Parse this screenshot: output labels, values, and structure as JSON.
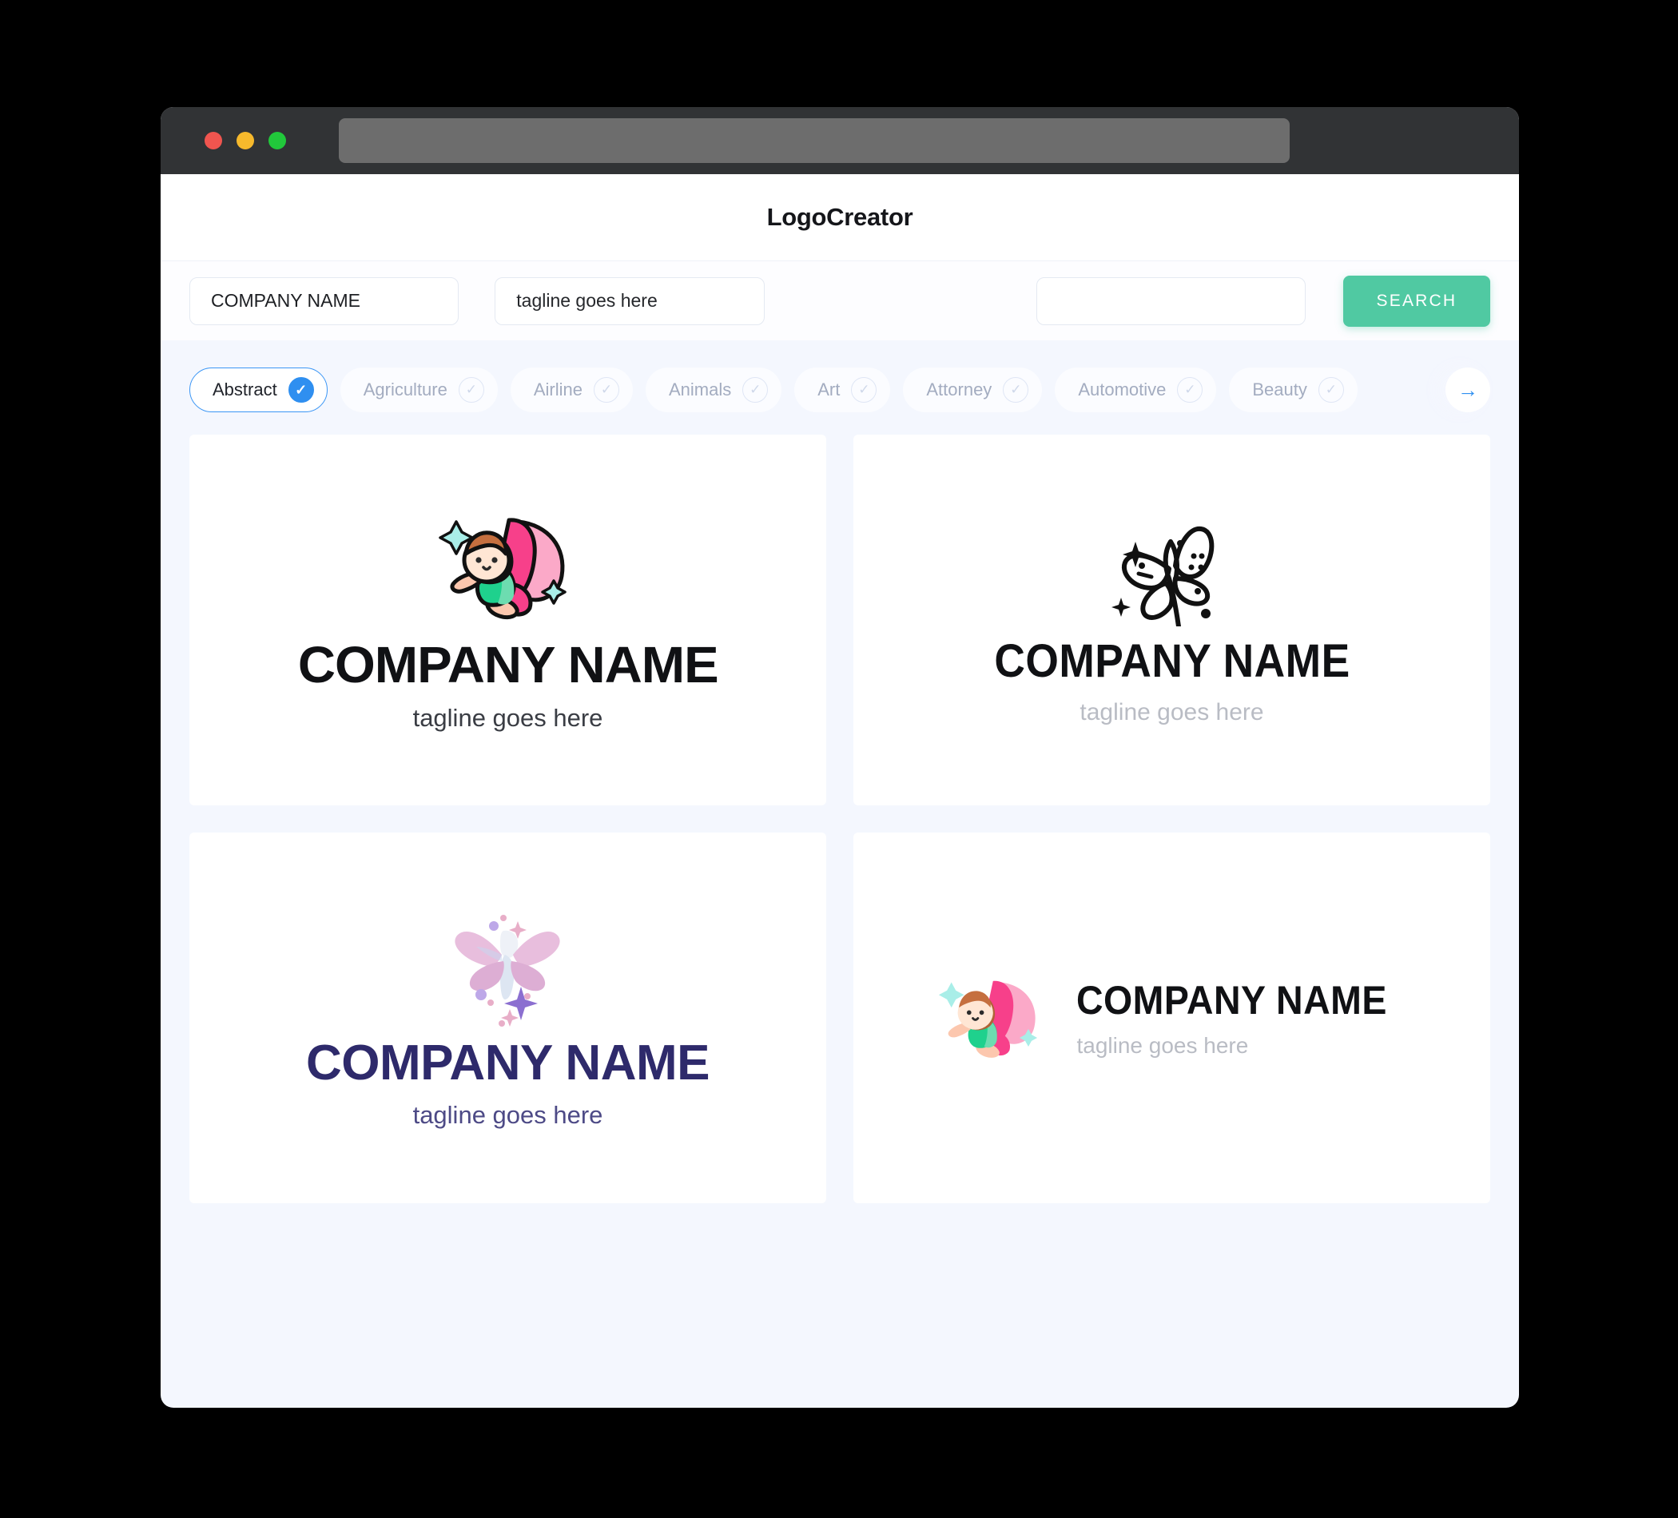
{
  "window": {
    "traffic_lights": [
      {
        "name": "close",
        "color": "#f0554f"
      },
      {
        "name": "minimize",
        "color": "#f6b92c"
      },
      {
        "name": "maximize",
        "color": "#21c83b"
      }
    ],
    "url_value": "",
    "url_placeholder": ""
  },
  "header": {
    "title": "LogoCreator"
  },
  "search": {
    "company_value": "COMPANY NAME",
    "company_placeholder": "COMPANY NAME",
    "tagline_value": "tagline goes here",
    "tagline_placeholder": "tagline goes here",
    "extra_value": "",
    "extra_placeholder": "",
    "button_label": "SEARCH",
    "button_color": "#50c9a2"
  },
  "categories": {
    "next_icon": "arrow-right-icon",
    "accent_color": "#2f8ff0",
    "items": [
      {
        "label": "Abstract",
        "selected": true
      },
      {
        "label": "Agriculture",
        "selected": false
      },
      {
        "label": "Airline",
        "selected": false
      },
      {
        "label": "Animals",
        "selected": false
      },
      {
        "label": "Art",
        "selected": false
      },
      {
        "label": "Attorney",
        "selected": false
      },
      {
        "label": "Automotive",
        "selected": false
      },
      {
        "label": "Beauty",
        "selected": false
      }
    ]
  },
  "logos": [
    {
      "id": "logo-1",
      "icon": "fairy-outlined-icon",
      "name": "COMPANY NAME",
      "tagline": "tagline goes here",
      "name_color": "#101114",
      "tagline_color": "#3a3d44",
      "layout": "stacked"
    },
    {
      "id": "logo-2",
      "icon": "butterfly-lineart-icon",
      "name": "COMPANY NAME",
      "tagline": "tagline goes here",
      "name_color": "#101114",
      "tagline_color": "#b9bcc4",
      "layout": "stacked"
    },
    {
      "id": "logo-3",
      "icon": "butterfly-fairy-pink-icon",
      "name": "COMPANY NAME",
      "tagline": "tagline goes here",
      "name_color": "#2e2a6b",
      "tagline_color": "#4d4a86",
      "layout": "stacked"
    },
    {
      "id": "logo-4",
      "icon": "fairy-flat-icon",
      "name": "COMPANY NAME",
      "tagline": "tagline goes here",
      "name_color": "#101114",
      "tagline_color": "#b9bcc4",
      "layout": "horizontal"
    }
  ]
}
